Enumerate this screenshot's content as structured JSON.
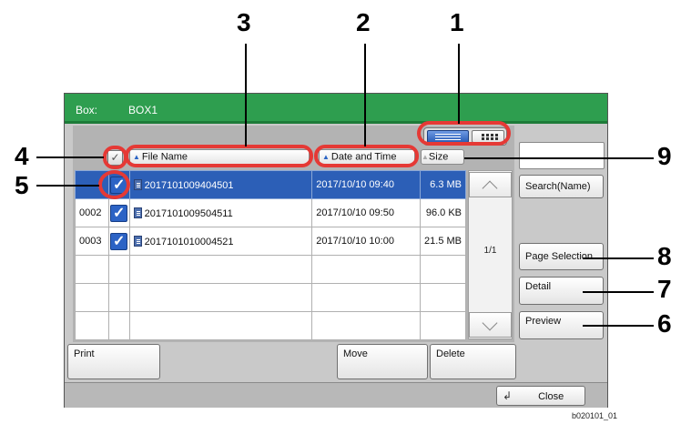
{
  "header": {
    "box_label": "Box:",
    "box_value": "BOX1"
  },
  "columns": {
    "file_name": "File Name",
    "date_time": "Date and Time",
    "size": "Size"
  },
  "rows": [
    {
      "num": "",
      "name": "2017101009404501",
      "date": "2017/10/10 09:40",
      "size": "6.3 MB",
      "selected": true
    },
    {
      "num": "0002",
      "name": "2017101009504511",
      "date": "2017/10/10 09:50",
      "size": "96.0 KB",
      "selected": false
    },
    {
      "num": "0003",
      "name": "2017101010004521",
      "date": "2017/10/10 10:00",
      "size": "21.5 MB",
      "selected": false
    }
  ],
  "pager": "1/1",
  "buttons": {
    "search": "Search(Name)",
    "page_selection": "Page Selection",
    "detail": "Detail",
    "preview": "Preview",
    "print": "Print",
    "move": "Move",
    "delete": "Delete",
    "close": "Close"
  },
  "callouts": {
    "c1": "1",
    "c2": "2",
    "c3": "3",
    "c4": "4",
    "c5": "5",
    "c6": "6",
    "c7": "7",
    "c8": "8",
    "c9": "9"
  },
  "caption": "b020101_01",
  "colors": {
    "title_bar": "#2e9e4f",
    "selection": "#2c5fb7",
    "callout_ring": "#e53935"
  }
}
